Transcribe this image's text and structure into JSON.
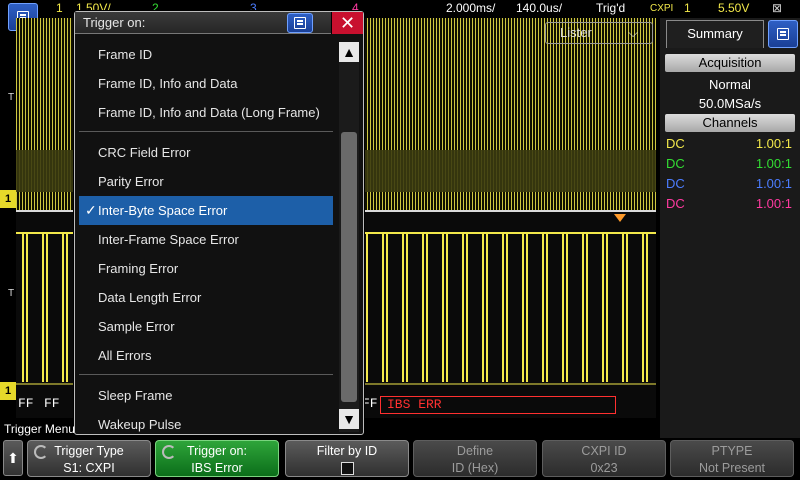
{
  "statusbar": {
    "ch1": "1",
    "volts": "1.50V/",
    "ch2": "2",
    "ch3": "3",
    "ch4": "4",
    "timebase": "2.000ms/",
    "delay": "140.0us/",
    "trig_state": "Trig'd",
    "trig_source": "CXPI",
    "trig_ch": "1",
    "trig_level": "5.50V"
  },
  "waveform": {
    "decode_left_1": "FF",
    "decode_left_2": "FF",
    "decode_mid": "FF",
    "error_label": "IBS ERR",
    "lister_label": "Lister",
    "trace_color": "#f2e84a",
    "error_color": "#ff3030"
  },
  "dialog": {
    "title": "Trigger on:",
    "close_label": "✕",
    "groups": [
      [
        "Frame ID",
        "Frame ID, Info and Data",
        "Frame ID, Info and Data (Long Frame)"
      ],
      [
        "CRC Field Error",
        "Parity Error",
        "Inter-Byte Space Error",
        "Inter-Frame Space Error",
        "Framing Error",
        "Data Length Error",
        "Sample Error",
        "All Errors"
      ],
      [
        "Sleep Frame",
        "Wakeup Pulse"
      ]
    ],
    "selected": "Inter-Byte Space Error",
    "selection_color": "#1d5fa8"
  },
  "summary": {
    "tab": "Summary",
    "acquisition_head": "Acquisition",
    "acq_mode": "Normal",
    "sample_rate": "50.0MSa/s",
    "channels_head": "Channels",
    "channels": [
      {
        "coupling": "DC",
        "ratio": "1.00:1",
        "color": "#f2e84a"
      },
      {
        "coupling": "DC",
        "ratio": "1.00:1",
        "color": "#33dd33"
      },
      {
        "coupling": "DC",
        "ratio": "1.00:1",
        "color": "#4c7dff"
      },
      {
        "coupling": "DC",
        "ratio": "1.00:1",
        "color": "#ff3aa0"
      }
    ]
  },
  "softkeys": {
    "menu_title": "Trigger Menu",
    "trigger_type_label": "Trigger Type",
    "trigger_type_value": "S1: CXPI",
    "trigger_on_label": "Trigger on:",
    "trigger_on_value": "IBS Error",
    "filter_label": "Filter by ID",
    "define_label": "Define",
    "define_value": "ID (Hex)",
    "cxpi_id_label": "CXPI ID",
    "cxpi_id_value": "0x23",
    "ptype_label": "PTYPE",
    "ptype_value": "Not Present"
  }
}
